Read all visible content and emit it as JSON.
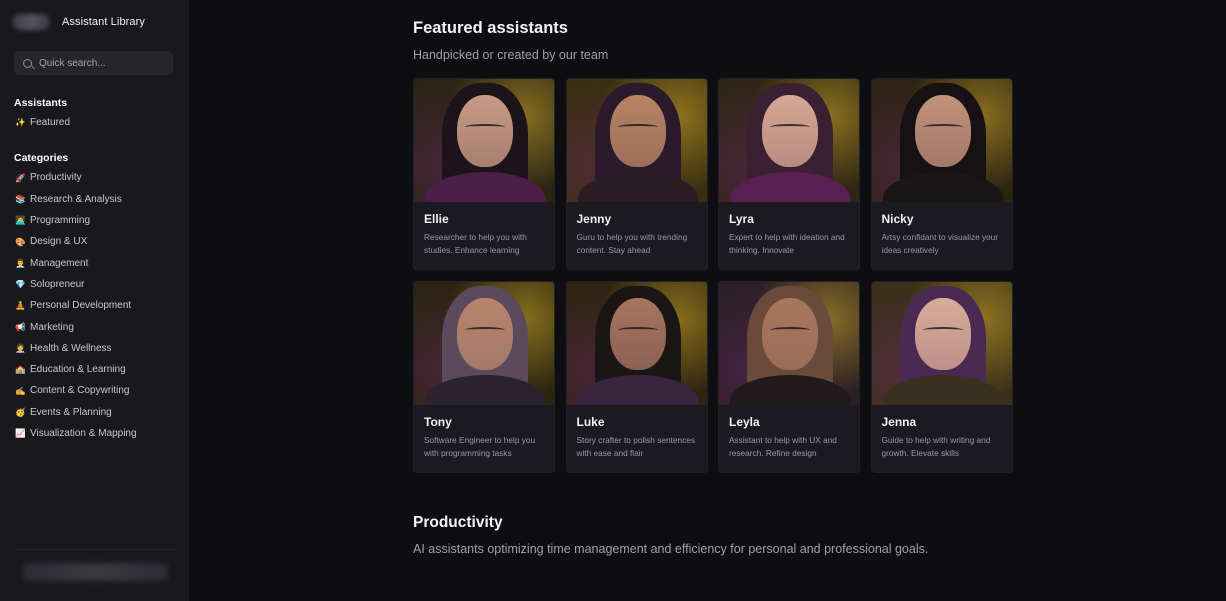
{
  "sidebar": {
    "title": "Assistant Library",
    "search_placeholder": "Quick search...",
    "assistants_heading": "Assistants",
    "assistants_items": [
      {
        "emoji": "✨",
        "label": "Featured"
      }
    ],
    "categories_heading": "Categories",
    "categories": [
      {
        "emoji": "🚀",
        "label": "Productivity"
      },
      {
        "emoji": "📚",
        "label": "Research & Analysis"
      },
      {
        "emoji": "👩‍💻",
        "label": "Programming"
      },
      {
        "emoji": "🎨",
        "label": "Design & UX"
      },
      {
        "emoji": "👨‍💼",
        "label": "Management"
      },
      {
        "emoji": "💎",
        "label": "Solopreneur"
      },
      {
        "emoji": "🧘",
        "label": "Personal Development"
      },
      {
        "emoji": "📢",
        "label": "Marketing"
      },
      {
        "emoji": "🧑‍⚕️",
        "label": "Health & Wellness"
      },
      {
        "emoji": "🏫",
        "label": "Education & Learning"
      },
      {
        "emoji": "✍️",
        "label": "Content & Copywriting"
      },
      {
        "emoji": "🥳",
        "label": "Events & Planning"
      },
      {
        "emoji": "📈",
        "label": "Visualization & Mapping"
      }
    ]
  },
  "featured": {
    "title": "Featured assistants",
    "subtitle": "Handpicked or created by our team",
    "cards": [
      {
        "name": "Ellie",
        "desc": "Researcher to help you with studies. Enhance learning",
        "bg": "#2a2415",
        "hair": "#1c1418",
        "skin": "#c99a86",
        "body": "#4b1f48"
      },
      {
        "name": "Jenny",
        "desc": "Guru to help you with trending content. Stay ahead",
        "bg": "#3a2e10",
        "hair": "#2b1a2c",
        "skin": "#b88464",
        "body": "#2a1d24"
      },
      {
        "name": "Lyra",
        "desc": "Expert to help with ideation and thinking. Innovate",
        "bg": "#2e2614",
        "hair": "#3a2030",
        "skin": "#d6a894",
        "body": "#5a1f52"
      },
      {
        "name": "Nicky",
        "desc": "Artsy confidant to visualize your ideas creatively",
        "bg": "#2c2412",
        "hair": "#161214",
        "skin": "#c4927c",
        "body": "#1a1618"
      },
      {
        "name": "Tony",
        "desc": "Software Engineer to help you with programming tasks",
        "bg": "#2a2410",
        "hair": "#5a4a5c",
        "skin": "#b8846c",
        "body": "#2c2230"
      },
      {
        "name": "Luke",
        "desc": "Story crafter to polish sentences with ease and flair",
        "bg": "#2e2410",
        "hair": "#1a1616",
        "skin": "#a87460",
        "body": "#3a2440"
      },
      {
        "name": "Leyla",
        "desc": "Assistant to help with UX and research. Refine design",
        "bg": "#2a1f24",
        "hair": "#6a4a3a",
        "skin": "#a8765e",
        "body": "#201a1c"
      },
      {
        "name": "Jenna",
        "desc": "Guide to help with writing and growth. Elevate skills",
        "bg": "#3a3018",
        "hair": "#4a2a52",
        "skin": "#d8ac98",
        "body": "#3a3020"
      }
    ]
  },
  "productivity": {
    "title": "Productivity",
    "subtitle": "AI assistants optimizing time management and efficiency for personal and professional goals."
  },
  "icons": {
    "search": "search-icon"
  }
}
